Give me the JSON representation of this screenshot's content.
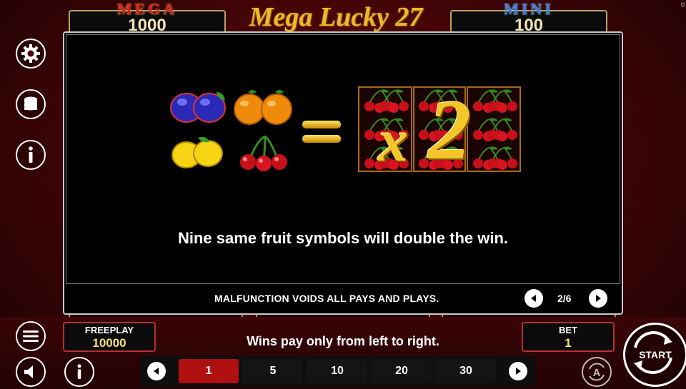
{
  "corner_label": "0",
  "jackpots": {
    "mega": {
      "title": "MEGA",
      "value": "1000"
    },
    "mini": {
      "title": "MINI",
      "value": "100"
    }
  },
  "logo": "Mega Lucky 27",
  "info": {
    "multiplier_x": "x",
    "multiplier_value": "2",
    "description": "Nine same fruit symbols will double the win.",
    "disclaimer": "MALFUNCTION VOIDS ALL PAYS AND PLAYS.",
    "page": "2/6"
  },
  "freeplay": {
    "label": "FREEPLAY",
    "value": "10000"
  },
  "bet": {
    "label": "BET",
    "value": "1"
  },
  "wins_note": "Wins pay only from left to right.",
  "bet_options": [
    "1",
    "5",
    "10",
    "20",
    "30"
  ],
  "selected_bet_index": 0,
  "start_label": "START",
  "auto_label": "A",
  "colors": {
    "accent_gold": "#f3c72a",
    "selected_bet": "#b01010",
    "background": "#3c0406"
  },
  "icons": {
    "settings": "gear-icon",
    "coins": "coin-stack-icon",
    "info": "info-icon",
    "menu": "menu-icon",
    "sound": "speaker-icon"
  }
}
